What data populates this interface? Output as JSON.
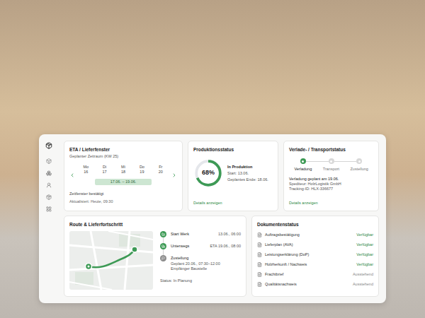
{
  "eta": {
    "title": "ETA / Lieferfenster",
    "subtitle": "Geplanter Zeitraum (KW 25)",
    "days": [
      {
        "weekday": "Mo",
        "date": "16",
        "in_window": false
      },
      {
        "weekday": "Di",
        "date": "17",
        "in_window": true
      },
      {
        "weekday": "Mi",
        "date": "18",
        "in_window": true
      },
      {
        "weekday": "Do",
        "date": "19",
        "in_window": true
      },
      {
        "weekday": "Fr",
        "date": "20",
        "in_window": false
      }
    ],
    "window_label": "17.06. – 19.06.",
    "confirmed": "Zeitfenster bestätigt",
    "updated": "Aktualisiert: Heute, 09:30"
  },
  "production": {
    "title": "Produktionsstatus",
    "percent": "68%",
    "level": 0.68,
    "status": "In Produktion",
    "start": "Start: 13.06.",
    "end": "Geplantes Ende: 18.06.",
    "link": "Details anzeigen"
  },
  "transport": {
    "title": "Verlade- / Transportstatus",
    "steps": [
      {
        "label": "Verladung",
        "selected": true
      },
      {
        "label": "Transport",
        "selected": false
      },
      {
        "label": "Zustellung",
        "selected": false
      }
    ],
    "lines": [
      "Verladung geplant am 19.06.",
      "Spediteur: HolzLogistik GmbH",
      "Tracking-ID: HLX-336677"
    ],
    "link": "Details anzeigen"
  },
  "route": {
    "title": "Route & Lieferfortschritt",
    "stops": [
      {
        "label": "Start Werk",
        "time": "13.06., 06:00",
        "details": [],
        "done": true
      },
      {
        "label": "Unterwegs",
        "time": "ETA 19.06., 08:00",
        "details": [],
        "done": true
      },
      {
        "label": "Zustellung",
        "time": "",
        "details": [
          "Geplant 20.06., 07:30–12:00",
          "Empfänger Baustelle"
        ],
        "done": false
      }
    ],
    "status": "Status: In Planung"
  },
  "documents": {
    "title": "Dokumentenstatus",
    "rows": [
      {
        "name": "Auftragsbestätigung",
        "status": "Verfügbar",
        "available": true
      },
      {
        "name": "Lieferplan (AVA)",
        "status": "Verfügbar",
        "available": true
      },
      {
        "name": "Leistungserklärung (DoP)",
        "status": "Verfügbar",
        "available": true
      },
      {
        "name": "Holzherkunft / Nachweis",
        "status": "Verfügbar",
        "available": true
      },
      {
        "name": "Frachtbrief",
        "status": "Ausstehend",
        "available": false
      },
      {
        "name": "Qualitätsnachweis",
        "status": "Ausstehend",
        "available": false
      }
    ]
  }
}
